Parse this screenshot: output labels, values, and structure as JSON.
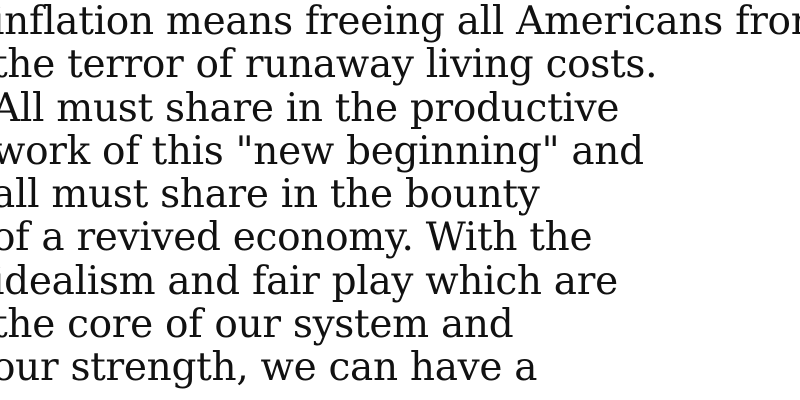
{
  "document": {
    "lines": [
      "inflation means freeing all Americans from",
      "the terror of runaway living costs.",
      "All must share in the productive",
      "work of this \"new beginning\" and",
      "all must share in the bounty",
      "of a revived economy. With the",
      "idealism and fair play which are",
      "the core of our system and",
      "our strength, we can have a"
    ]
  }
}
